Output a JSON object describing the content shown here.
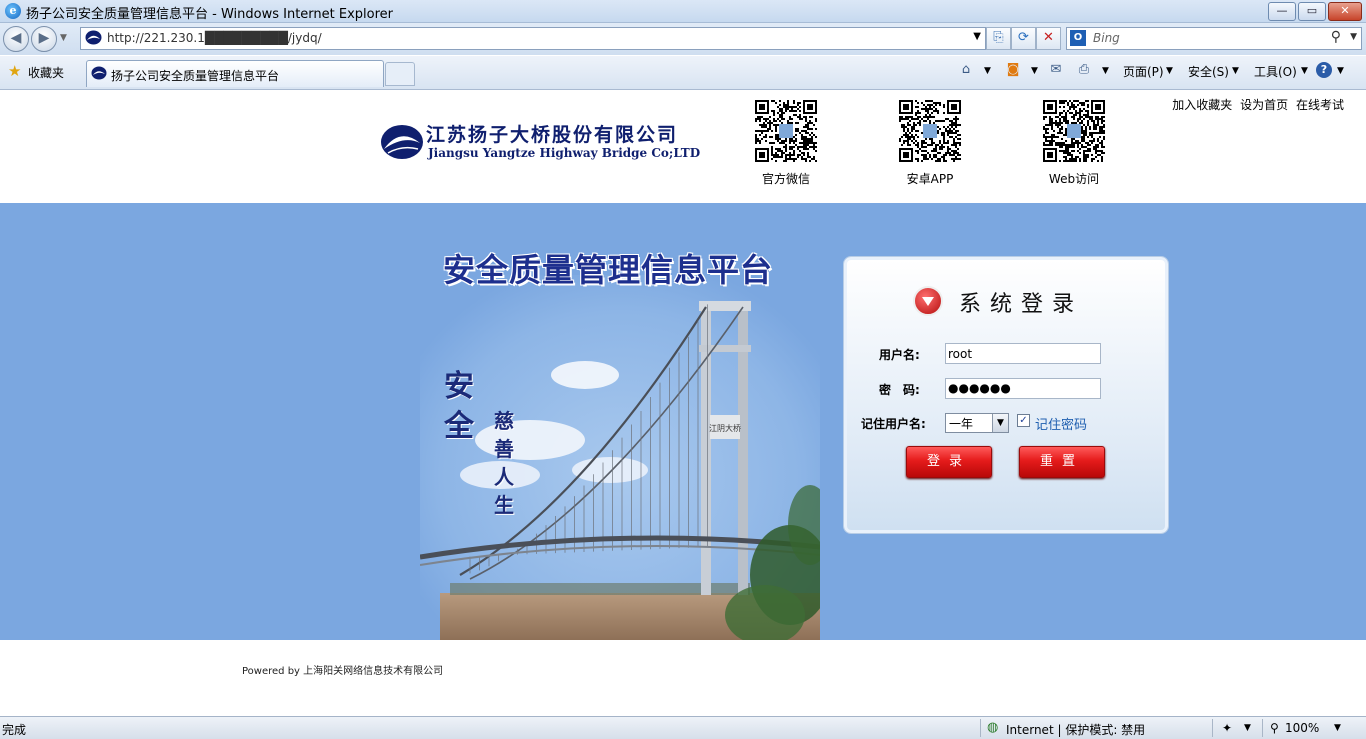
{
  "browser": {
    "window_title": "扬子公司安全质量管理信息平台 - Windows Internet Explorer",
    "window_buttons": {
      "minimize": "—",
      "restore": "▭",
      "close": "✕"
    },
    "address": "http://221.230.1█████████/jydq/",
    "search_placeholder": "Bing",
    "favorites_label": "收藏夹",
    "tab_title": "扬子公司安全质量管理信息平台",
    "commands": {
      "page": "页面(P)",
      "safety": "安全(S)",
      "tools": "工具(O)"
    },
    "icons": {
      "back": "back-arrow-icon",
      "forward": "forward-arrow-icon",
      "refresh": "refresh-icon",
      "stop": "stop-icon",
      "compat": "compatibility-view-icon",
      "search": "search-icon",
      "home": "home-icon",
      "rss": "rss-feed-icon",
      "mail": "mail-icon",
      "print": "print-icon",
      "help": "help-icon",
      "favorites": "star-icon"
    }
  },
  "header": {
    "company_cn": "江苏扬子大桥股份有限公司",
    "company_en": "Jiangsu Yangtze Highway Bridge Co;LTD",
    "qr_codes": [
      {
        "label": "官方微信"
      },
      {
        "label": "安卓APP"
      },
      {
        "label": "Web访问"
      }
    ],
    "top_links": [
      "加入收藏夹",
      "设为首页",
      "在线考试"
    ]
  },
  "banner": {
    "platform_title": "安全质量管理信息平台",
    "slogan_big": [
      "安",
      "全"
    ],
    "slogan_small": [
      "慈",
      "善",
      "人",
      "生"
    ]
  },
  "login": {
    "title": "系统登录",
    "username_label": "用户名:",
    "username_value": "root",
    "password_label": "密　码:",
    "password_value": "●●●●●●",
    "remember_label": "记住用户名:",
    "remember_option": "一年",
    "remember_password_label": "记住密码",
    "remember_password_checked": true,
    "login_button": "登录",
    "reset_button": "重置"
  },
  "footer": {
    "powered_by": "Powered by 上海阳关网络信息技术有限公司"
  },
  "status": {
    "left": "完成",
    "zone": "Internet | 保护模式: 禁用",
    "zoom": "100%"
  },
  "colors": {
    "banner_bg": "#7ba7e0",
    "brand_navy": "#0f1f6e",
    "button_red": "#e51b1b",
    "title_blue": "#1d2f8e"
  }
}
